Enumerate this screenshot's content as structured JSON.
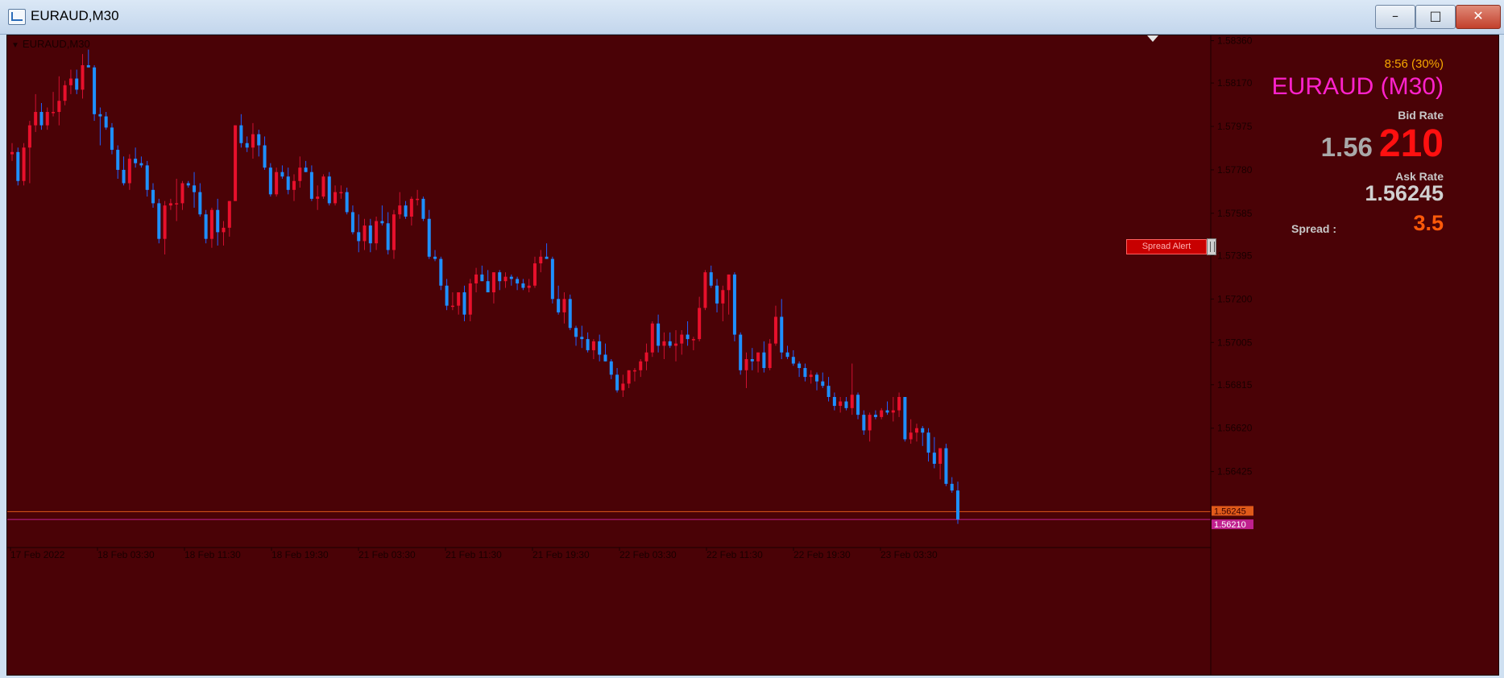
{
  "window": {
    "title": "EURAUD,M30",
    "minimize_icon": "minimize-icon",
    "maximize_icon": "maximize-icon",
    "close_icon": "close-icon"
  },
  "chart_label": "EURAUD,M30",
  "info_panel": {
    "timer": "8:56 (30%)",
    "symbol": "EURAUD (M30)",
    "bid_label": "Bid Rate",
    "bid_main": "1.56",
    "bid_pips": "210",
    "ask_label": "Ask Rate",
    "ask_value": "1.56245",
    "spread_label": "Spread  :",
    "spread_value": "3.5",
    "spread_alert_button": "Spread Alert"
  },
  "colors": {
    "background": "#4a0206",
    "bull_candle": "#e8102c",
    "bear_candle": "#1e90ff",
    "bull_wick": "#d01030",
    "bear_wick": "#2060ff",
    "ask_line": "#e05a1a",
    "bid_line": "#c0208e",
    "axis_text": "#1a0000"
  },
  "chart_data": {
    "type": "candlestick",
    "symbol": "EURAUD",
    "timeframe": "M30",
    "ylim": [
      1.5612,
      1.5838
    ],
    "y_ticks": [
      "1.58360",
      "1.58170",
      "1.57975",
      "1.57780",
      "1.57585",
      "1.57395",
      "1.57200",
      "1.57005",
      "1.56815",
      "1.56620",
      "1.56425"
    ],
    "x_ticks": [
      "17 Feb 2022",
      "18 Feb 03:30",
      "18 Feb 11:30",
      "18 Feb 19:30",
      "21 Feb 03:30",
      "21 Feb 11:30",
      "21 Feb 19:30",
      "22 Feb 03:30",
      "22 Feb 11:30",
      "22 Feb 19:30",
      "23 Feb 03:30"
    ],
    "price_lines": [
      {
        "label": "1.56245",
        "value": 1.56245,
        "kind": "ask"
      },
      {
        "label": "1.56210",
        "value": 1.5621,
        "kind": "bid"
      }
    ],
    "candles": [
      [
        1.5785,
        1.579,
        1.5782,
        1.5786
      ],
      [
        1.5786,
        1.5788,
        1.5771,
        1.5773
      ],
      [
        1.5773,
        1.579,
        1.5771,
        1.5788
      ],
      [
        1.5788,
        1.58,
        1.5772,
        1.5798
      ],
      [
        1.5798,
        1.5812,
        1.5795,
        1.5804
      ],
      [
        1.5804,
        1.5808,
        1.5796,
        1.5798
      ],
      [
        1.5798,
        1.5806,
        1.5796,
        1.5804
      ],
      [
        1.5804,
        1.5813,
        1.5802,
        1.5804
      ],
      [
        1.5804,
        1.582,
        1.5798,
        1.5809
      ],
      [
        1.5809,
        1.5818,
        1.5807,
        1.5816
      ],
      [
        1.5816,
        1.5823,
        1.5812,
        1.5819
      ],
      [
        1.5819,
        1.5823,
        1.5812,
        1.5814
      ],
      [
        1.5814,
        1.583,
        1.581,
        1.5825
      ],
      [
        1.5825,
        1.5832,
        1.5824,
        1.5824
      ],
      [
        1.5824,
        1.5825,
        1.58,
        1.5803
      ],
      [
        1.5803,
        1.5806,
        1.5789,
        1.5802
      ],
      [
        1.5802,
        1.5804,
        1.5796,
        1.5797
      ],
      [
        1.5797,
        1.5799,
        1.5785,
        1.5787
      ],
      [
        1.5787,
        1.5789,
        1.5774,
        1.5778
      ],
      [
        1.5778,
        1.5784,
        1.5771,
        1.5772
      ],
      [
        1.5772,
        1.5785,
        1.5769,
        1.5783
      ],
      [
        1.5783,
        1.5788,
        1.5779,
        1.5781
      ],
      [
        1.5781,
        1.5784,
        1.5779,
        1.578
      ],
      [
        1.578,
        1.5782,
        1.5766,
        1.5769
      ],
      [
        1.5769,
        1.5772,
        1.5761,
        1.5763
      ],
      [
        1.5763,
        1.5765,
        1.5745,
        1.5747
      ],
      [
        1.5747,
        1.5764,
        1.574,
        1.5762
      ],
      [
        1.5762,
        1.5765,
        1.576,
        1.5763
      ],
      [
        1.5763,
        1.5774,
        1.5755,
        1.5763
      ],
      [
        1.5763,
        1.5773,
        1.576,
        1.5772
      ],
      [
        1.5772,
        1.5773,
        1.577,
        1.5771
      ],
      [
        1.5771,
        1.5777,
        1.5761,
        1.5768
      ],
      [
        1.5768,
        1.5772,
        1.5757,
        1.5758
      ],
      [
        1.5758,
        1.576,
        1.5745,
        1.5747
      ],
      [
        1.5747,
        1.5761,
        1.5743,
        1.576
      ],
      [
        1.576,
        1.5765,
        1.5744,
        1.575
      ],
      [
        1.575,
        1.5755,
        1.5744,
        1.5752
      ],
      [
        1.5752,
        1.5764,
        1.5748,
        1.5764
      ],
      [
        1.5764,
        1.5798,
        1.5764,
        1.5798
      ],
      [
        1.5798,
        1.5803,
        1.5788,
        1.579
      ],
      [
        1.579,
        1.5793,
        1.5786,
        1.5788
      ],
      [
        1.5788,
        1.5799,
        1.5783,
        1.5794
      ],
      [
        1.5794,
        1.5796,
        1.5784,
        1.5789
      ],
      [
        1.5789,
        1.5793,
        1.5778,
        1.5779
      ],
      [
        1.5779,
        1.5781,
        1.5766,
        1.5767
      ],
      [
        1.5767,
        1.5779,
        1.5766,
        1.5777
      ],
      [
        1.5777,
        1.578,
        1.5774,
        1.5775
      ],
      [
        1.5775,
        1.5779,
        1.5767,
        1.5769
      ],
      [
        1.5769,
        1.5776,
        1.5764,
        1.5773
      ],
      [
        1.5773,
        1.5784,
        1.577,
        1.5779
      ],
      [
        1.5779,
        1.5782,
        1.5777,
        1.5777
      ],
      [
        1.5777,
        1.578,
        1.5764,
        1.5765
      ],
      [
        1.5765,
        1.5771,
        1.576,
        1.5766
      ],
      [
        1.5766,
        1.5776,
        1.5765,
        1.5775
      ],
      [
        1.5775,
        1.5777,
        1.5762,
        1.5763
      ],
      [
        1.5763,
        1.5771,
        1.5762,
        1.5768
      ],
      [
        1.5768,
        1.5771,
        1.5765,
        1.5768
      ],
      [
        1.5768,
        1.577,
        1.5758,
        1.5759
      ],
      [
        1.5759,
        1.5762,
        1.5749,
        1.575
      ],
      [
        1.575,
        1.5758,
        1.5741,
        1.5746
      ],
      [
        1.5746,
        1.5756,
        1.5742,
        1.5753
      ],
      [
        1.5753,
        1.5756,
        1.5741,
        1.5745
      ],
      [
        1.5745,
        1.5757,
        1.5742,
        1.5755
      ],
      [
        1.5755,
        1.5762,
        1.5753,
        1.5754
      ],
      [
        1.5754,
        1.5759,
        1.574,
        1.5742
      ],
      [
        1.5742,
        1.576,
        1.5738,
        1.5758
      ],
      [
        1.5758,
        1.5768,
        1.5756,
        1.5762
      ],
      [
        1.5762,
        1.5764,
        1.5756,
        1.5757
      ],
      [
        1.5757,
        1.5766,
        1.5753,
        1.5765
      ],
      [
        1.5765,
        1.5769,
        1.5762,
        1.5765
      ],
      [
        1.5765,
        1.5766,
        1.5755,
        1.5756
      ],
      [
        1.5756,
        1.576,
        1.5738,
        1.5739
      ],
      [
        1.5739,
        1.5742,
        1.5737,
        1.5738
      ],
      [
        1.5738,
        1.5739,
        1.5724,
        1.5726
      ],
      [
        1.5726,
        1.5729,
        1.5715,
        1.5717
      ],
      [
        1.5717,
        1.5723,
        1.5715,
        1.5717
      ],
      [
        1.5717,
        1.5723,
        1.5713,
        1.5723
      ],
      [
        1.5723,
        1.5726,
        1.571,
        1.5713
      ],
      [
        1.5713,
        1.5729,
        1.571,
        1.5727
      ],
      [
        1.5727,
        1.5734,
        1.5723,
        1.5731
      ],
      [
        1.5731,
        1.5735,
        1.5728,
        1.5728
      ],
      [
        1.5728,
        1.5733,
        1.5727,
        1.5723
      ],
      [
        1.5723,
        1.5732,
        1.5718,
        1.5732
      ],
      [
        1.5732,
        1.5733,
        1.5724,
        1.5728
      ],
      [
        1.5728,
        1.5732,
        1.5725,
        1.573
      ],
      [
        1.573,
        1.5731,
        1.5726,
        1.5729
      ],
      [
        1.5729,
        1.573,
        1.5724,
        1.5727
      ],
      [
        1.5727,
        1.5729,
        1.5724,
        1.5725
      ],
      [
        1.5725,
        1.5729,
        1.5723,
        1.5726
      ],
      [
        1.5726,
        1.5739,
        1.5725,
        1.5736
      ],
      [
        1.5736,
        1.5742,
        1.5732,
        1.5739
      ],
      [
        1.5739,
        1.5745,
        1.5738,
        1.5738
      ],
      [
        1.5738,
        1.5739,
        1.5718,
        1.572
      ],
      [
        1.572,
        1.5726,
        1.5713,
        1.5714
      ],
      [
        1.5714,
        1.5723,
        1.5709,
        1.572
      ],
      [
        1.572,
        1.5722,
        1.5706,
        1.5707
      ],
      [
        1.5707,
        1.5708,
        1.5699,
        1.5703
      ],
      [
        1.5703,
        1.5708,
        1.5698,
        1.5702
      ],
      [
        1.5702,
        1.5705,
        1.5696,
        1.5697
      ],
      [
        1.5697,
        1.5702,
        1.5693,
        1.5701
      ],
      [
        1.5701,
        1.5704,
        1.5692,
        1.5695
      ],
      [
        1.5695,
        1.57,
        1.5692,
        1.5692
      ],
      [
        1.5692,
        1.5693,
        1.5684,
        1.5686
      ],
      [
        1.5686,
        1.5689,
        1.5678,
        1.5679
      ],
      [
        1.5679,
        1.5686,
        1.5676,
        1.5682
      ],
      [
        1.5682,
        1.5688,
        1.568,
        1.5688
      ],
      [
        1.5688,
        1.5689,
        1.5683,
        1.5688
      ],
      [
        1.5688,
        1.5693,
        1.5685,
        1.5692
      ],
      [
        1.5692,
        1.57,
        1.5688,
        1.5696
      ],
      [
        1.5696,
        1.571,
        1.5694,
        1.5709
      ],
      [
        1.5709,
        1.5713,
        1.5696,
        1.5699
      ],
      [
        1.5699,
        1.5705,
        1.5693,
        1.5701
      ],
      [
        1.5701,
        1.5705,
        1.5698,
        1.5699
      ],
      [
        1.5699,
        1.5706,
        1.5692,
        1.57
      ],
      [
        1.57,
        1.5706,
        1.5695,
        1.5704
      ],
      [
        1.5704,
        1.571,
        1.5699,
        1.5702
      ],
      [
        1.5702,
        1.5703,
        1.5697,
        1.5702
      ],
      [
        1.5702,
        1.5721,
        1.5701,
        1.5716
      ],
      [
        1.5716,
        1.5733,
        1.5715,
        1.5732
      ],
      [
        1.5732,
        1.5735,
        1.5725,
        1.5726
      ],
      [
        1.5726,
        1.5729,
        1.5714,
        1.5718
      ],
      [
        1.5718,
        1.5726,
        1.571,
        1.5724
      ],
      [
        1.5724,
        1.5731,
        1.5713,
        1.5731
      ],
      [
        1.5731,
        1.5732,
        1.5701,
        1.5704
      ],
      [
        1.5704,
        1.5705,
        1.5686,
        1.5688
      ],
      [
        1.5688,
        1.5696,
        1.568,
        1.5693
      ],
      [
        1.5693,
        1.5698,
        1.5688,
        1.5692
      ],
      [
        1.5692,
        1.5696,
        1.5687,
        1.5696
      ],
      [
        1.5696,
        1.5701,
        1.5687,
        1.5689
      ],
      [
        1.5689,
        1.5702,
        1.5688,
        1.57
      ],
      [
        1.57,
        1.5717,
        1.5699,
        1.5712
      ],
      [
        1.5712,
        1.572,
        1.5693,
        1.5696
      ],
      [
        1.5696,
        1.5699,
        1.5693,
        1.5694
      ],
      [
        1.5694,
        1.5697,
        1.569,
        1.5691
      ],
      [
        1.5691,
        1.5692,
        1.5685,
        1.5689
      ],
      [
        1.5689,
        1.5691,
        1.5683,
        1.5685
      ],
      [
        1.5685,
        1.5688,
        1.5682,
        1.5686
      ],
      [
        1.5686,
        1.5687,
        1.5679,
        1.5683
      ],
      [
        1.5683,
        1.5687,
        1.568,
        1.5681
      ],
      [
        1.5681,
        1.5685,
        1.5674,
        1.5676
      ],
      [
        1.5676,
        1.5678,
        1.567,
        1.5672
      ],
      [
        1.5672,
        1.5676,
        1.5669,
        1.5674
      ],
      [
        1.5674,
        1.5676,
        1.567,
        1.5671
      ],
      [
        1.5671,
        1.5691,
        1.5668,
        1.5677
      ],
      [
        1.5677,
        1.5678,
        1.5666,
        1.5668
      ],
      [
        1.5668,
        1.567,
        1.5659,
        1.5661
      ],
      [
        1.5661,
        1.5669,
        1.5656,
        1.5668
      ],
      [
        1.5668,
        1.567,
        1.5666,
        1.5667
      ],
      [
        1.5667,
        1.5671,
        1.5666,
        1.567
      ],
      [
        1.567,
        1.5674,
        1.5668,
        1.5669
      ],
      [
        1.5669,
        1.5676,
        1.5665,
        1.567
      ],
      [
        1.567,
        1.5678,
        1.5667,
        1.5676
      ],
      [
        1.5676,
        1.5676,
        1.5656,
        1.5657
      ],
      [
        1.5657,
        1.5666,
        1.5655,
        1.566
      ],
      [
        1.566,
        1.5664,
        1.5656,
        1.5662
      ],
      [
        1.5662,
        1.5663,
        1.5654,
        1.566
      ],
      [
        1.566,
        1.5662,
        1.5647,
        1.5651
      ],
      [
        1.5651,
        1.5658,
        1.5644,
        1.5646
      ],
      [
        1.5646,
        1.5653,
        1.5639,
        1.5653
      ],
      [
        1.5653,
        1.5655,
        1.5636,
        1.5637
      ],
      [
        1.5637,
        1.564,
        1.5633,
        1.5634
      ],
      [
        1.5634,
        1.5638,
        1.5619,
        1.5621
      ]
    ]
  }
}
